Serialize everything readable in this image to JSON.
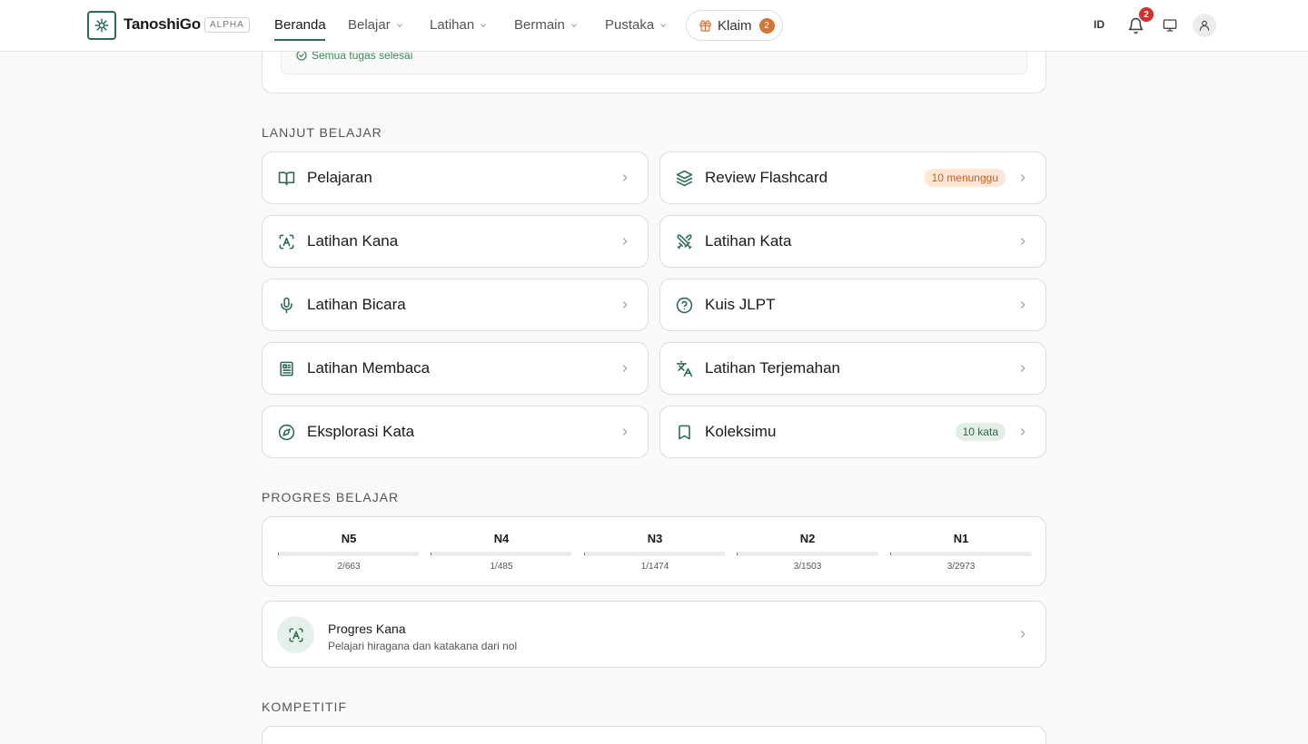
{
  "header": {
    "brand": "TanoshiGo",
    "badge": "ALPHA",
    "nav": [
      {
        "label": "Beranda",
        "active": true
      },
      {
        "label": "Belajar"
      },
      {
        "label": "Latihan"
      },
      {
        "label": "Bermain"
      },
      {
        "label": "Pustaka"
      }
    ],
    "claim_label": "Klaim",
    "claim_count": "2",
    "language": "ID",
    "notification_count": "2"
  },
  "daily": {
    "status": "Semua tugas selesai"
  },
  "continue": {
    "title": "LANJUT BELAJAR",
    "items": [
      {
        "label": "Pelajaran",
        "icon": "book-open-icon"
      },
      {
        "label": "Review Flashcard",
        "icon": "layers-icon",
        "badge": "10 menunggu"
      },
      {
        "label": "Latihan Kana",
        "icon": "scan-text-icon"
      },
      {
        "label": "Latihan Kata",
        "icon": "swords-icon"
      },
      {
        "label": "Latihan Bicara",
        "icon": "mic-icon"
      },
      {
        "label": "Kuis JLPT",
        "icon": "help-circle-icon"
      },
      {
        "label": "Latihan Membaca",
        "icon": "newspaper-icon"
      },
      {
        "label": "Latihan Terjemahan",
        "icon": "languages-icon"
      },
      {
        "label": "Eksplorasi Kata",
        "icon": "compass-icon"
      },
      {
        "label": "Koleksimu",
        "icon": "bookmark-icon",
        "badge": "10 kata"
      }
    ]
  },
  "progress": {
    "title": "PROGRES BELAJAR",
    "levels": [
      {
        "name": "N5",
        "count": "2/663",
        "fraction": 0.003
      },
      {
        "name": "N4",
        "count": "1/485",
        "fraction": 0.002
      },
      {
        "name": "N3",
        "count": "1/1474",
        "fraction": 0.0007
      },
      {
        "name": "N2",
        "count": "3/1503",
        "fraction": 0.002
      },
      {
        "name": "N1",
        "count": "3/2973",
        "fraction": 0.001
      }
    ]
  },
  "kana": {
    "title": "Progres Kana",
    "subtitle": "Pelajari hiragana dan katakana dari nol"
  },
  "competitive": {
    "title": "KOMPETITIF"
  },
  "colors": {
    "accent": "#2d6a4f",
    "claim_badge": "#d4753a",
    "notification": "#d32f2f"
  }
}
